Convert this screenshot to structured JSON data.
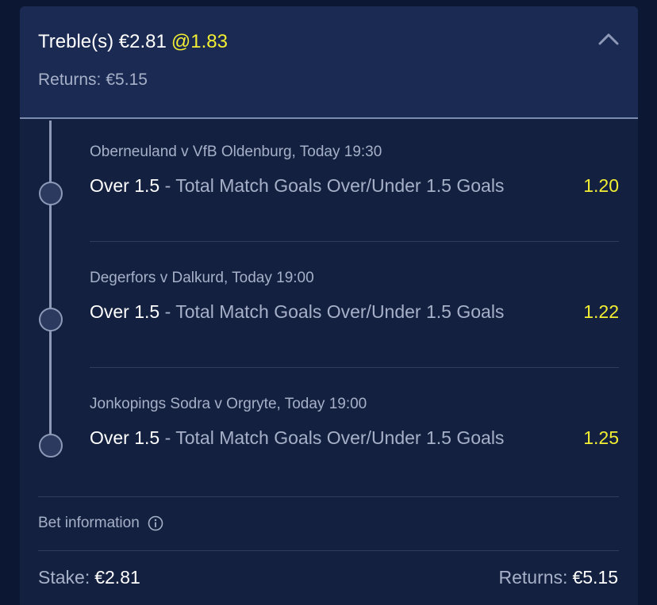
{
  "header": {
    "bet_type": "Treble(s) €2.81",
    "odds": "@1.83",
    "returns_label": "Returns:",
    "returns_value": "€5.15"
  },
  "selections": [
    {
      "event": "Oberneuland v VfB Oldenburg, Today 19:30",
      "pick": "Over 1.5",
      "market": " - Total Match Goals Over/Under 1.5 Goals",
      "odds": "1.20"
    },
    {
      "event": "Degerfors v Dalkurd, Today 19:00",
      "pick": "Over 1.5",
      "market": " - Total Match Goals Over/Under 1.5 Goals",
      "odds": "1.22"
    },
    {
      "event": "Jonkopings Sodra v Orgryte, Today 19:00",
      "pick": "Over 1.5",
      "market": " - Total Match Goals Over/Under 1.5 Goals",
      "odds": "1.25"
    }
  ],
  "bet_info": {
    "label": "Bet information",
    "icon": "info-icon"
  },
  "footer": {
    "stake_label": "Stake:",
    "stake_value": "€2.81",
    "returns_label": "Returns:",
    "returns_value": "€5.15"
  },
  "colors": {
    "background": "#0c1733",
    "card": "#13203f",
    "header": "#1b2a52",
    "odds_yellow": "#f2ee33",
    "muted_text": "#a6b0c8"
  }
}
